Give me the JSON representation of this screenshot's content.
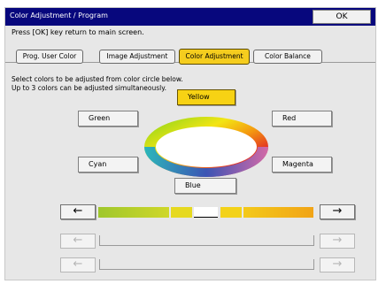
{
  "window": {
    "title": "Color Adjustment / Program",
    "ok_label": "OK"
  },
  "instruction": "Press [OK] key return to main screen.",
  "tabs": [
    {
      "label": "Prog. User Color"
    },
    {
      "label": "Image Adjustment"
    },
    {
      "label": "Color Adjustment",
      "active": true
    },
    {
      "label": "Color Balance"
    }
  ],
  "select_text": {
    "line1": "Select colors to be adjusted from color circle below.",
    "line2": "Up to 3 colors can be adjusted simultaneously."
  },
  "colors": {
    "yellow": "Yellow",
    "green": "Green",
    "red": "Red",
    "cyan": "Cyan",
    "magenta": "Magenta",
    "blue": "Blue"
  },
  "sliders": [
    {
      "enabled": true,
      "left_icon": "arrow-left-icon",
      "right_icon": "arrow-right-icon"
    },
    {
      "enabled": false,
      "left_icon": "arrow-left-icon",
      "right_icon": "arrow-right-icon"
    },
    {
      "enabled": false,
      "left_icon": "arrow-left-icon",
      "right_icon": "arrow-right-icon"
    }
  ],
  "accent_colors": {
    "titlebar": "#07077d",
    "active_tab": "#f5cd1e",
    "yellow_button": "#f7d214"
  }
}
